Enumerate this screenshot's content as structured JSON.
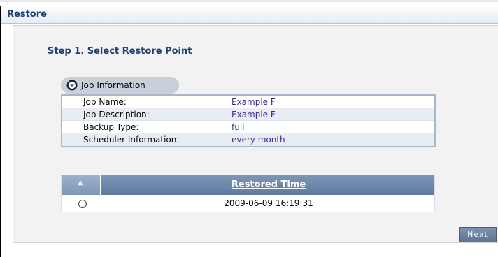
{
  "header": {
    "title": "Restore"
  },
  "step": {
    "title": "Step 1. Select Restore Point"
  },
  "section": {
    "label": "Job Information",
    "icon": "expand-circle-icon"
  },
  "job_info": [
    {
      "key": "Job Name:",
      "value": "Example F"
    },
    {
      "key": "Job Description:",
      "value": "Example F"
    },
    {
      "key": "Backup Type:",
      "value": "full"
    },
    {
      "key": "Scheduler Information:",
      "value": "every month"
    }
  ],
  "restore_table": {
    "sort_icon": "sort-up-icon",
    "column_header": "Restored Time",
    "rows": [
      {
        "time": "2009-06-09 16:19:31",
        "selected": false
      }
    ]
  },
  "actions": {
    "next_label": "Next"
  },
  "colors": {
    "accent": "#1d3f74",
    "value_text": "#3a2a8c",
    "table_header": "#6f88ab",
    "button": "#6b82a4"
  }
}
